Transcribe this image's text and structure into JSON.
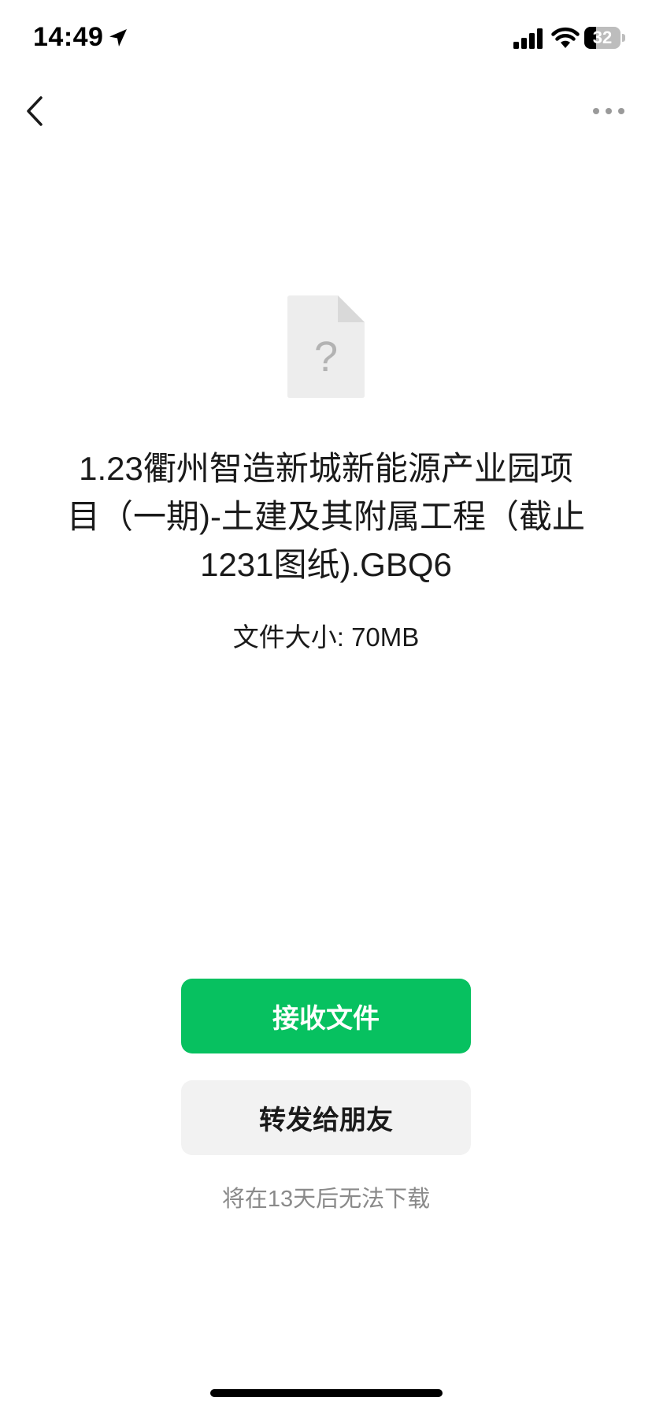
{
  "status_bar": {
    "time": "14:49",
    "battery_level": "32",
    "battery_fraction": 0.32,
    "icons": [
      "location-arrow-icon",
      "cellular-signal-icon",
      "wifi-icon",
      "battery-icon"
    ]
  },
  "nav": {
    "back_icon": "chevron-left-icon",
    "more_icon": "more-dots-icon"
  },
  "file": {
    "icon": "unknown-file-icon",
    "icon_glyph": "?",
    "name": "1.23衢州智造新城新能源产业园项目（一期)-土建及其附属工程（截止1231图纸).GBQ6",
    "size_label": "文件大小: ",
    "size_value": "70MB"
  },
  "actions": {
    "receive_label": "接收文件",
    "forward_label": "转发给朋友"
  },
  "expiry_note": "将在13天后无法下载",
  "colors": {
    "accent_green": "#07c160",
    "secondary_button": "#f2f2f2",
    "muted_text": "#8a8a8a"
  }
}
